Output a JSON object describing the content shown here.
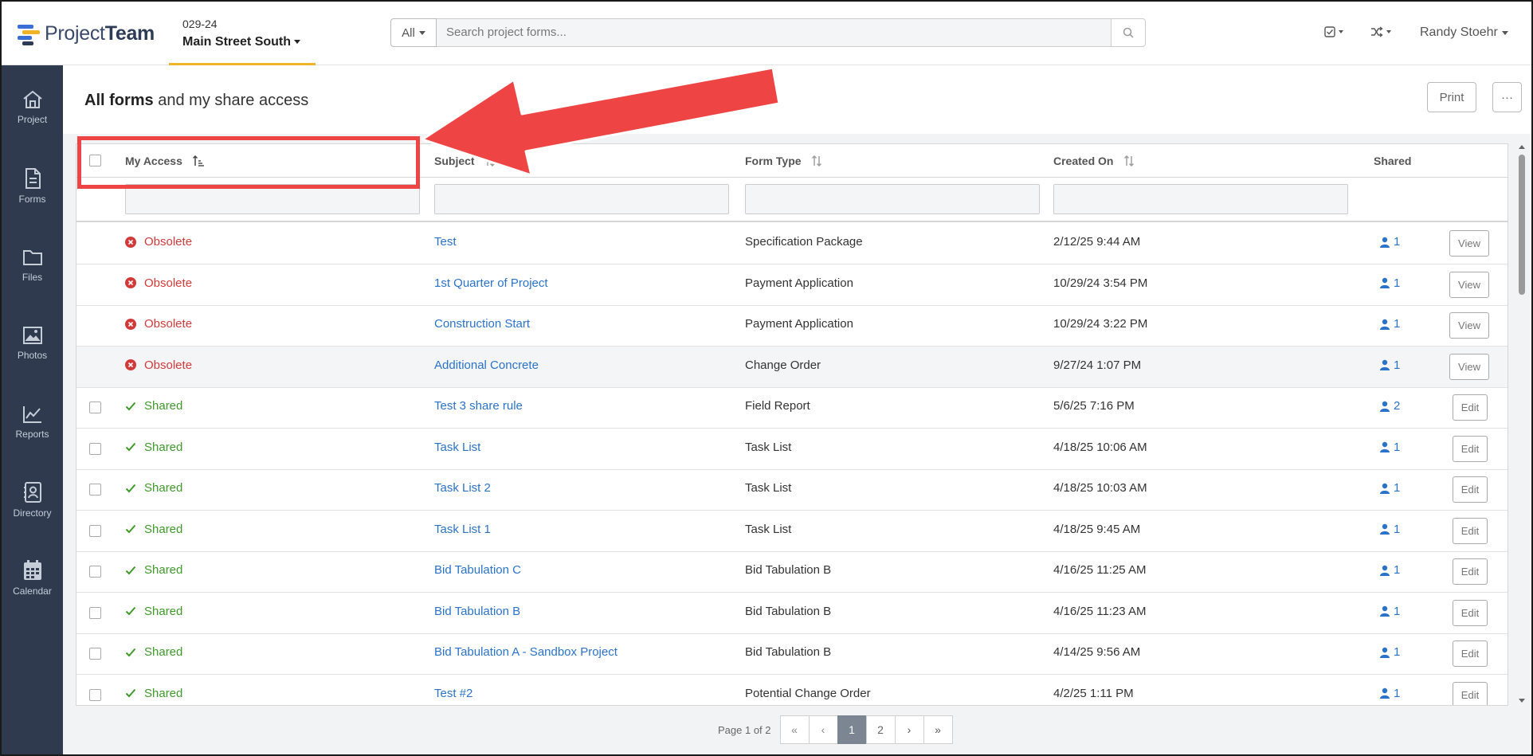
{
  "app": {
    "logo_text_light": "Project",
    "logo_text_bold": "Team"
  },
  "project": {
    "number": "029-24",
    "name": "Main Street South"
  },
  "search": {
    "scope": "All",
    "placeholder": "Search project forms..."
  },
  "user": {
    "name": "Randy Stoehr"
  },
  "sidebar": {
    "items": [
      {
        "label": "Project",
        "icon": "home-icon"
      },
      {
        "label": "Forms",
        "icon": "document-icon"
      },
      {
        "label": "Files",
        "icon": "folder-icon"
      },
      {
        "label": "Photos",
        "icon": "image-icon"
      },
      {
        "label": "Reports",
        "icon": "chart-line-icon"
      },
      {
        "label": "Directory",
        "icon": "contact-card-icon"
      },
      {
        "label": "Calendar",
        "icon": "calendar-icon"
      }
    ]
  },
  "page": {
    "title_bold": "All forms",
    "title_rest": " and my share access",
    "print_label": "Print",
    "more_label": "···"
  },
  "table": {
    "columns": {
      "access": "My Access",
      "subject": "Subject",
      "form_type": "Form Type",
      "created_on": "Created On",
      "shared": "Shared"
    },
    "rows": [
      {
        "access": "Obsolete",
        "subject": "Test",
        "form_type": "Specification Package",
        "created_on": "2/12/25 9:44 AM",
        "shared": "1",
        "action": "View"
      },
      {
        "access": "Obsolete",
        "subject": "1st Quarter of Project",
        "form_type": "Payment Application",
        "created_on": "10/29/24 3:54 PM",
        "shared": "1",
        "action": "View"
      },
      {
        "access": "Obsolete",
        "subject": "Construction Start",
        "form_type": "Payment Application",
        "created_on": "10/29/24 3:22 PM",
        "shared": "1",
        "action": "View"
      },
      {
        "access": "Obsolete",
        "subject": "Additional Concrete",
        "form_type": "Change Order",
        "created_on": "9/27/24 1:07 PM",
        "shared": "1",
        "action": "View"
      },
      {
        "access": "Shared",
        "subject": "Test 3 share rule",
        "form_type": "Field Report",
        "created_on": "5/6/25 7:16 PM",
        "shared": "2",
        "action": "Edit"
      },
      {
        "access": "Shared",
        "subject": "Task List",
        "form_type": "Task List",
        "created_on": "4/18/25 10:06 AM",
        "shared": "1",
        "action": "Edit"
      },
      {
        "access": "Shared",
        "subject": "Task List 2",
        "form_type": "Task List",
        "created_on": "4/18/25 10:03 AM",
        "shared": "1",
        "action": "Edit"
      },
      {
        "access": "Shared",
        "subject": "Task List 1",
        "form_type": "Task List",
        "created_on": "4/18/25 9:45 AM",
        "shared": "1",
        "action": "Edit"
      },
      {
        "access": "Shared",
        "subject": "Bid Tabulation C",
        "form_type": "Bid Tabulation B",
        "created_on": "4/16/25 11:25 AM",
        "shared": "1",
        "action": "Edit"
      },
      {
        "access": "Shared",
        "subject": "Bid Tabulation B",
        "form_type": "Bid Tabulation B",
        "created_on": "4/16/25 11:23 AM",
        "shared": "1",
        "action": "Edit"
      },
      {
        "access": "Shared",
        "subject": "Bid Tabulation A - Sandbox Project",
        "form_type": "Bid Tabulation B",
        "created_on": "4/14/25 9:56 AM",
        "shared": "1",
        "action": "Edit"
      },
      {
        "access": "Shared",
        "subject": "Test #2",
        "form_type": "Potential Change Order",
        "created_on": "4/2/25 1:11 PM",
        "shared": "1",
        "action": "Edit"
      }
    ]
  },
  "pagination": {
    "label": "Page 1 of 2",
    "first": "«",
    "prev": "‹",
    "pages": [
      "1",
      "2"
    ],
    "current": "1",
    "next": "›",
    "last": "»"
  },
  "colors": {
    "sidebar_bg": "#2f3a4e",
    "link": "#2b73c8",
    "obsolete": "#d23a3a",
    "shared": "#3f9a2b",
    "project_underline": "#f0b429",
    "annotation": "#ee4444"
  }
}
